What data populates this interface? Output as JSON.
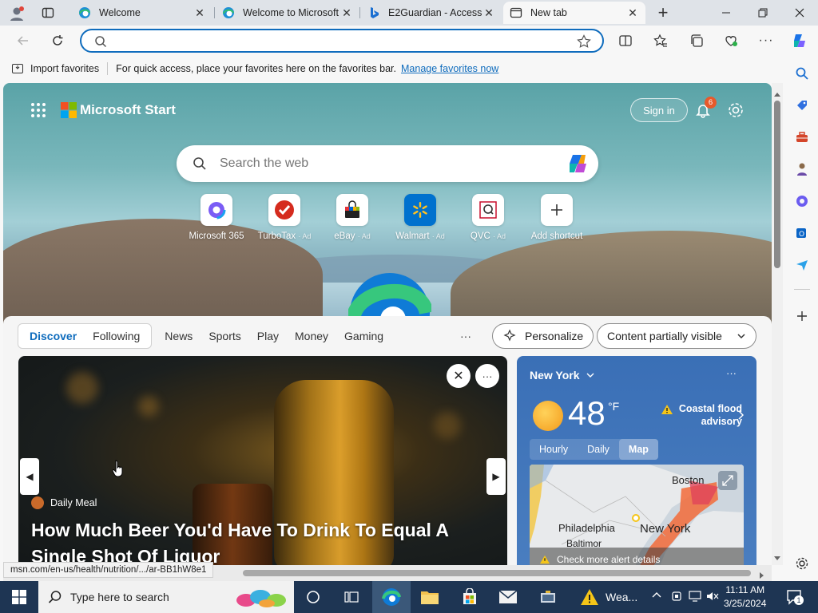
{
  "tabs": [
    {
      "title": "Welcome",
      "close": "✕"
    },
    {
      "title": "Welcome to Microsoft",
      "close": "✕"
    },
    {
      "title": "E2Guardian - Access",
      "close": "✕"
    },
    {
      "title": "New tab",
      "close": "✕"
    }
  ],
  "new_tab_button": "+",
  "address": {
    "value": "",
    "placeholder": ""
  },
  "favorites_bar": {
    "import": "Import favorites",
    "message": "For quick access, place your favorites here on the favorites bar.",
    "manage_link": "Manage favorites now"
  },
  "ms_start": {
    "brand": "Microsoft Start",
    "sign_in": "Sign in",
    "notification_count": "6",
    "search_placeholder": "Search the web"
  },
  "shortcuts": [
    {
      "label": "Microsoft 365",
      "ad": ""
    },
    {
      "label": "TurboTax",
      "ad": "· Ad"
    },
    {
      "label": "eBay",
      "ad": "· Ad"
    },
    {
      "label": "Walmart",
      "ad": "· Ad"
    },
    {
      "label": "QVC",
      "ad": "· Ad"
    },
    {
      "label": "Add shortcut",
      "ad": ""
    }
  ],
  "feed_nav": {
    "items": [
      "Discover",
      "Following",
      "News",
      "Sports",
      "Play",
      "Money",
      "Gaming"
    ],
    "more": "···",
    "personalize": "Personalize",
    "content_visibility": "Content partially visible"
  },
  "article": {
    "source": "Daily Meal",
    "title": "How Much Beer You'd Have To Drink To Equal A Single Shot Of Liquor",
    "close": "✕",
    "more": "···"
  },
  "weather": {
    "city": "New York",
    "temperature": "48",
    "unit": "°F",
    "alert": "Coastal flood advisory",
    "tabs": [
      "Hourly",
      "Daily",
      "Map"
    ],
    "selected_tab": "Map",
    "map_labels": [
      "Boston",
      "Philadelphia",
      "New York",
      "Baltimor"
    ],
    "map_alert": "Check more alert details",
    "more": "···"
  },
  "status_url": "msn.com/en-us/health/nutrition/.../ar-BB1hW8e1",
  "taskbar": {
    "search_placeholder": "Type here to search",
    "weather_label": "Wea...",
    "time": "11:11 AM",
    "date": "3/25/2024",
    "notification_count": "1"
  },
  "colors": {
    "accent": "#0f6cbd",
    "taskbar": "#1e3553",
    "weather_card": "#3a6fb6",
    "badge": "#e8592b"
  }
}
